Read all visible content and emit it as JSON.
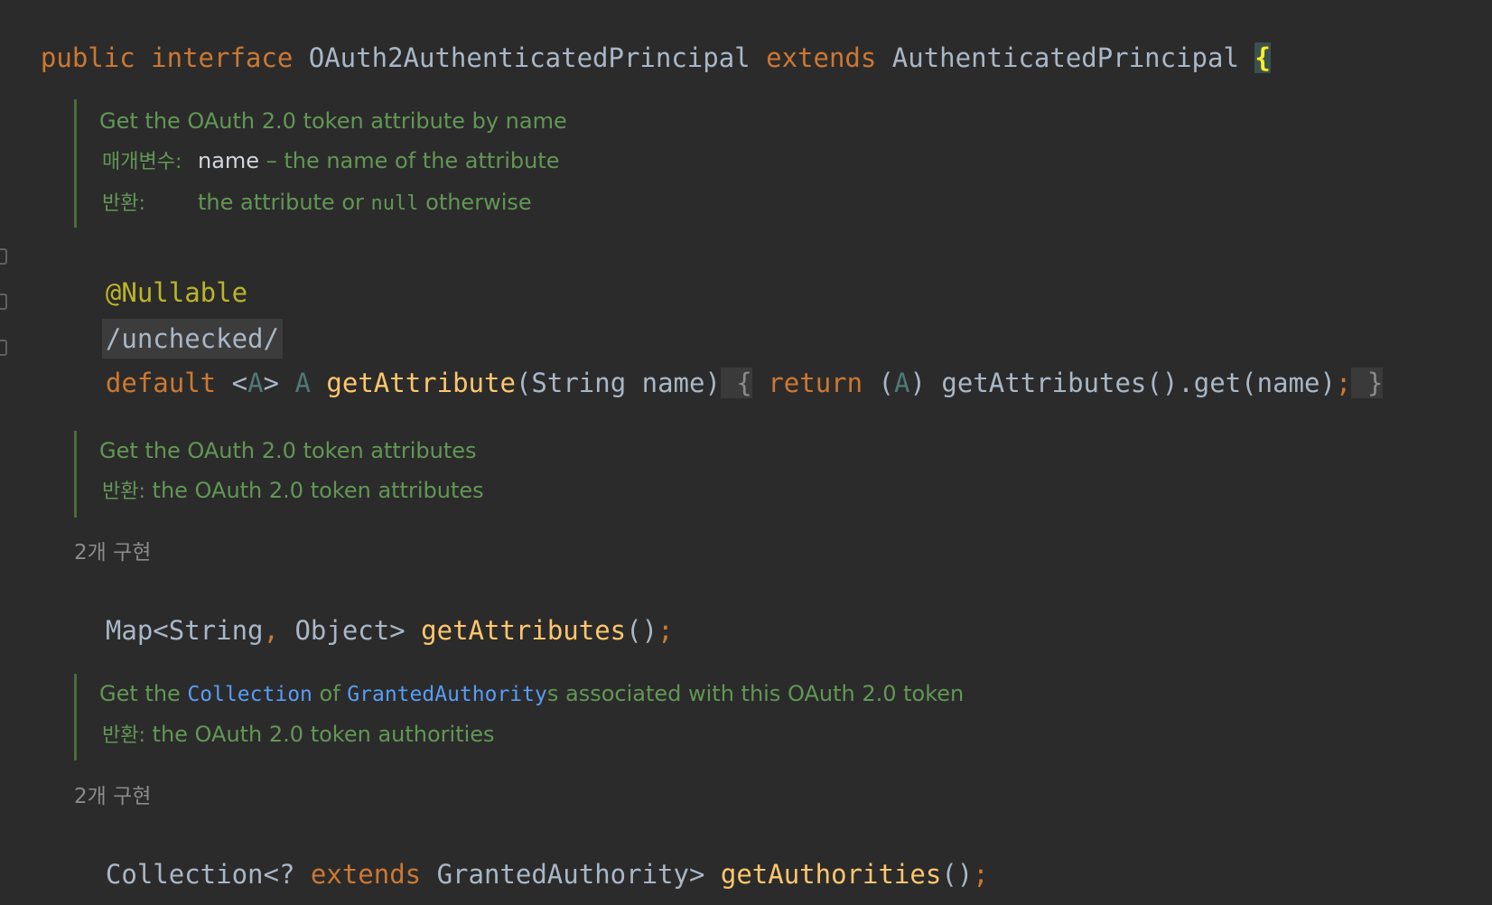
{
  "header": {
    "kw_public": "public",
    "kw_interface": "interface",
    "name": "OAuth2AuthenticatedPrincipal",
    "kw_extends": "extends",
    "parent": "AuthenticatedPrincipal",
    "brace": "{"
  },
  "doc_get_attribute": {
    "summary": "Get the OAuth 2.0 token attribute by name",
    "param_label": "매개변수:",
    "param_name": "name",
    "param_desc": " – the name of the attribute",
    "returns_label": "반환:",
    "returns_pre": "the attribute or ",
    "returns_code": "null",
    "returns_post": " otherwise"
  },
  "annotation": "@Nullable",
  "unchecked": "/unchecked/",
  "method_get_attribute": {
    "kw_default": "default",
    "lt": "<",
    "type_param": "A",
    "gt": ">",
    "return_type": "A",
    "name": "getAttribute",
    "params": "(String name)",
    "open_brace": " {",
    "kw_return": "return",
    "cast_open": "(",
    "cast_type": "A",
    "cast_close": ")",
    "body": "getAttributes().get(name)",
    "semicolon": ";",
    "close_brace": " }"
  },
  "doc_get_attributes": {
    "summary": "Get the OAuth 2.0 token attributes",
    "returns_label": "반환:",
    "returns_desc": " the OAuth 2.0 token attributes"
  },
  "impl_count_1": "2개 구현",
  "method_get_attributes": {
    "type_pre": "Map<String",
    "comma": ",",
    "type_post": " Object>",
    "name": "getAttributes",
    "parens": "()",
    "semicolon": ";"
  },
  "doc_get_authorities": {
    "text_1": "Get the ",
    "link_1": "Collection",
    "text_2": " of ",
    "link_2": "GrantedAuthority",
    "text_3": "s associated with this OAuth 2.0 token",
    "returns_label": "반환:",
    "returns_desc": " the OAuth 2.0 token authorities"
  },
  "impl_count_2": "2개 구현",
  "method_get_authorities": {
    "type_pre": "Collection<?",
    "kw_extends": "extends",
    "type_post": "GrantedAuthority>",
    "name": "getAuthorities",
    "parens": "()",
    "semicolon": ";"
  }
}
